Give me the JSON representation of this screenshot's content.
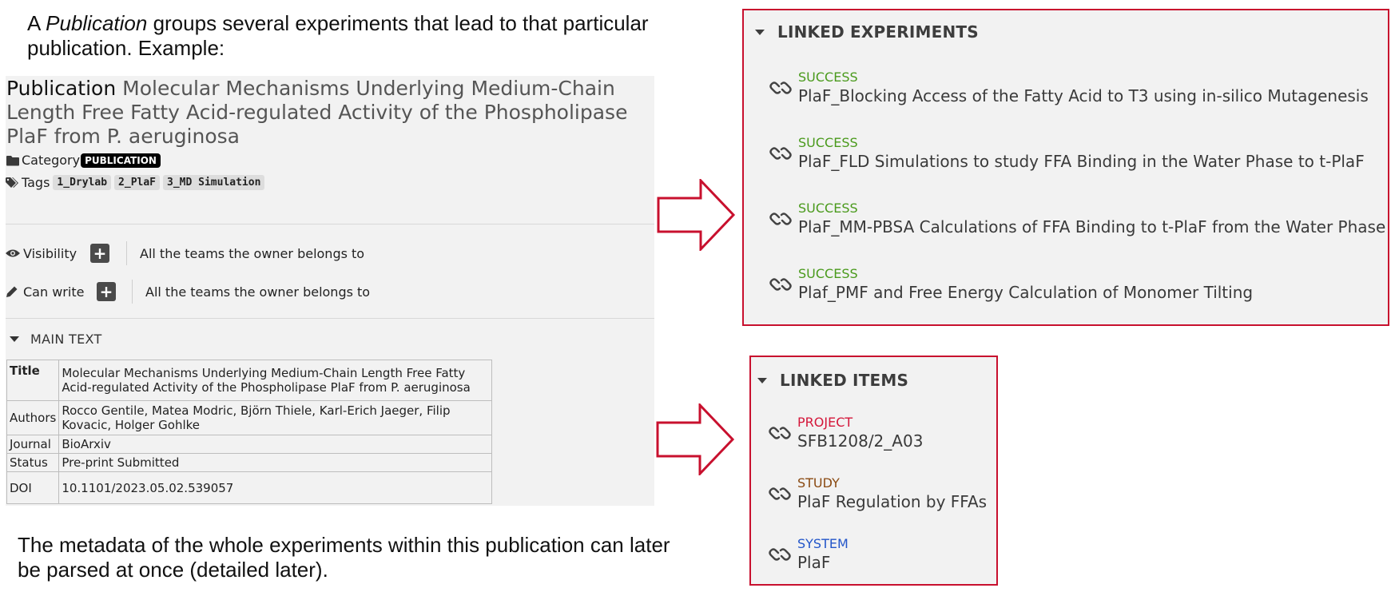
{
  "intro": {
    "prefix": "A ",
    "italic": "Publication",
    "suffix": " groups several experiments that lead to that particular publication. Example:"
  },
  "outro": "The metadata of the whole experiments within this publication can later be parsed at once (detailed later).",
  "publication": {
    "category_label": "Publication",
    "title": "Molecular Mechanisms Underlying Medium-Chain Length Free Fatty Acid-regulated Activity of the Phospholipase PlaF from P. aeruginosa",
    "category_field": "Category",
    "category_badge": "PUBLICATION",
    "tags_field": "Tags",
    "tags": [
      "1_Drylab",
      "2_PlaF",
      "3_MD Simulation"
    ],
    "visibility": {
      "label": "Visibility",
      "plus": "+",
      "value": "All the teams the owner belongs to"
    },
    "can_write": {
      "label": "Can write",
      "plus": "+",
      "value": "All the teams the owner belongs to"
    },
    "main_text_label": "MAIN TEXT",
    "table": [
      {
        "key": "Title",
        "value": "Molecular Mechanisms Underlying Medium-Chain Length Free Fatty Acid-regulated Activity of the Phospholipase PlaF from P. aeruginosa"
      },
      {
        "key": "Authors",
        "value": "Rocco Gentile, Matea Modric, Björn Thiele, Karl-Erich Jaeger,  Filip Kovacic, Holger Gohlke"
      },
      {
        "key": "Journal",
        "value": "BioArxiv"
      },
      {
        "key": "Status",
        "value": "Pre-print Submitted"
      },
      {
        "key": "DOI",
        "value": "10.1101/2023.05.02.539057"
      }
    ]
  },
  "linked_experiments": {
    "header": "LINKED EXPERIMENTS",
    "items": [
      {
        "status": "SUCCESS",
        "title": "PlaF_Blocking Access of the Fatty Acid to T3 using in-silico Mutagenesis"
      },
      {
        "status": "SUCCESS",
        "title": "PlaF_FLD Simulations to study FFA Binding in the Water Phase to t-PlaF"
      },
      {
        "status": "SUCCESS",
        "title": "PlaF_MM-PBSA Calculations of FFA Binding to t-PlaF from the Water Phase"
      },
      {
        "status": "SUCCESS",
        "title": "Plaf_PMF and Free Energy Calculation of Monomer Tilting"
      }
    ]
  },
  "linked_items": {
    "header": "LINKED ITEMS",
    "items": [
      {
        "category": "PROJECT",
        "title": "SFB1208/2_A03"
      },
      {
        "category": "STUDY",
        "title": "PlaF Regulation by FFAs"
      },
      {
        "category": "SYSTEM",
        "title": "PlaF"
      }
    ]
  },
  "colors": {
    "success": "#4a9a1c",
    "project": "#d4173a",
    "study": "#8a4a12",
    "system": "#2356c9",
    "frame": "#c8102e"
  },
  "icons": {
    "folder": "folder-icon",
    "tags": "tags-icon",
    "eye": "eye-icon",
    "pencil": "pencil-icon",
    "link": "link-icon"
  }
}
